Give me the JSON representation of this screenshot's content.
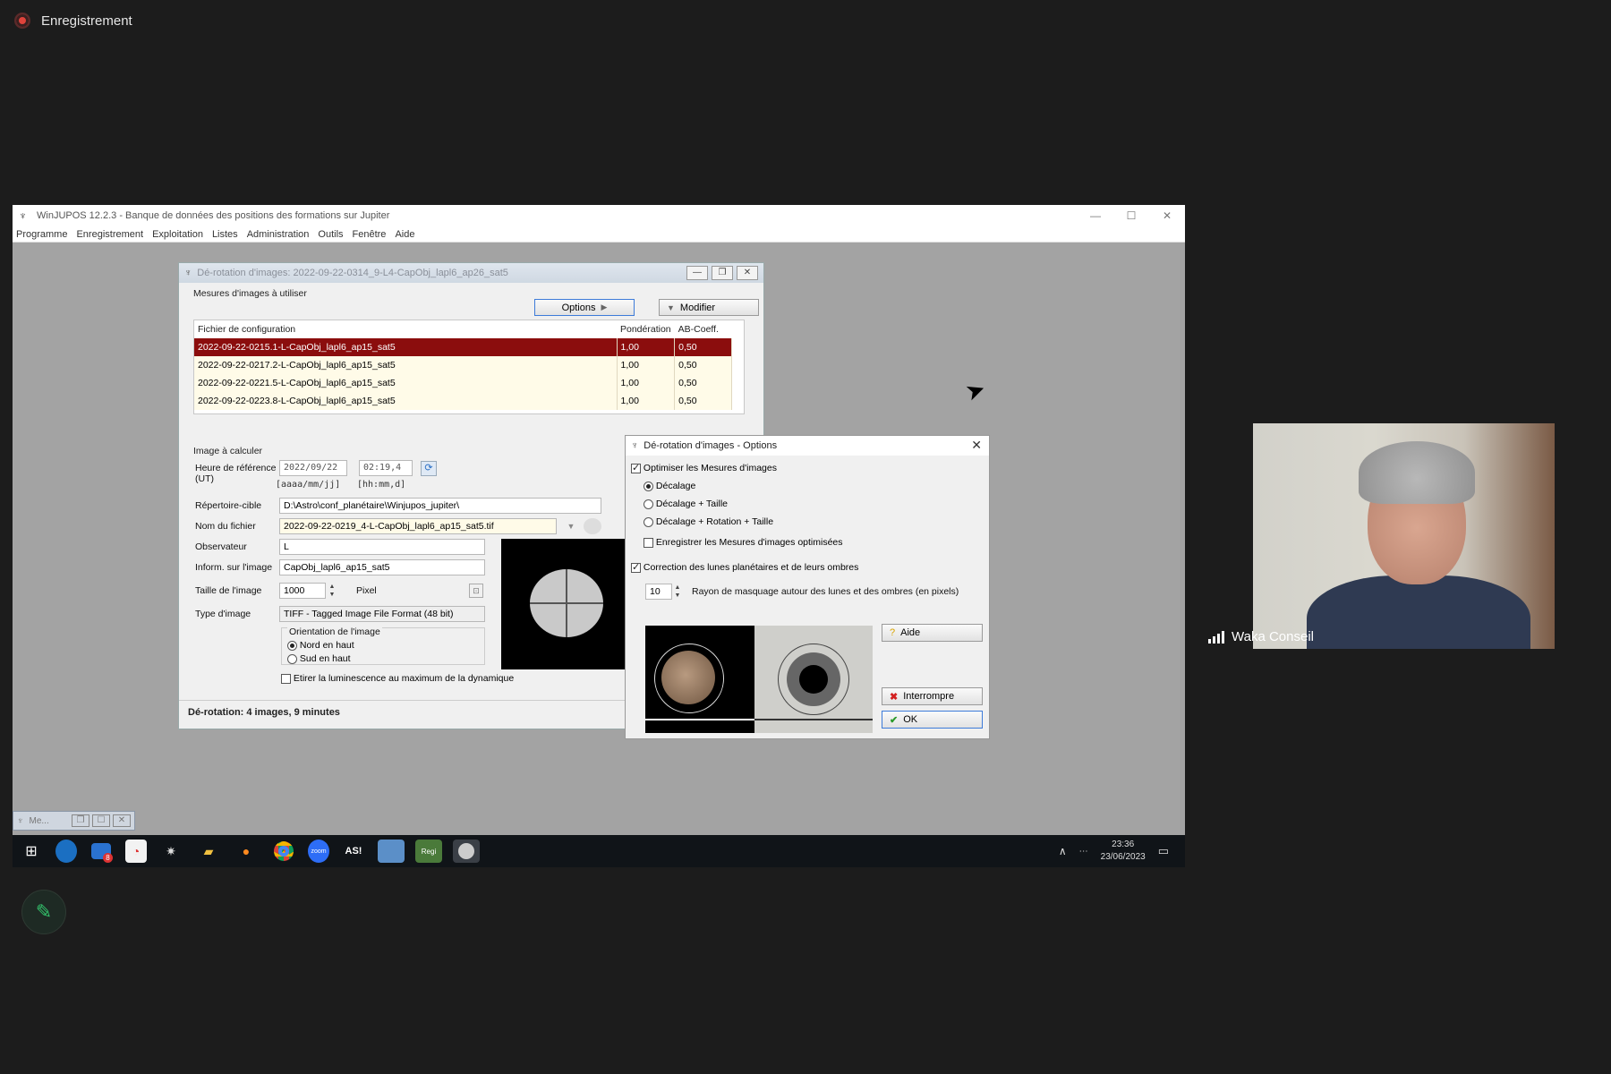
{
  "recording": {
    "label": "Enregistrement"
  },
  "app": {
    "title": "WinJUPOS 12.2.3 - Banque de données des positions des formations sur Jupiter",
    "menu": [
      "Programme",
      "Enregistrement",
      "Exploitation",
      "Listes",
      "Administration",
      "Outils",
      "Fenêtre",
      "Aide"
    ]
  },
  "derot_window": {
    "title": "Dé-rotation d'images: 2022-09-22-0314_9-L4-CapObj_lapl6_ap26_sat5",
    "group_measures": "Mesures d'images à utiliser",
    "options_btn": "Options",
    "modify_btn": "Modifier",
    "table": {
      "headers": [
        "Fichier de configuration",
        "Pondération",
        "AB-Coeff."
      ],
      "rows": [
        [
          "2022-09-22-0215.1-L-CapObj_lapl6_ap15_sat5",
          "1,00",
          "0,50"
        ],
        [
          "2022-09-22-0217.2-L-CapObj_lapl6_ap15_sat5",
          "1,00",
          "0,50"
        ],
        [
          "2022-09-22-0221.5-L-CapObj_lapl6_ap15_sat5",
          "1,00",
          "0,50"
        ],
        [
          "2022-09-22-0223.8-L-CapObj_lapl6_ap15_sat5",
          "1,00",
          "0,50"
        ]
      ]
    },
    "group_image": "Image à calculer",
    "ref_time_label": "Heure de référence (UT)",
    "ref_date": "2022/09/22",
    "ref_time": "02:19,4",
    "date_format": "[aaaa/mm/jj]",
    "time_format": "[hh:mm,d]",
    "target_dir_label": "Répertoire-cible",
    "target_dir": "D:\\Astro\\conf_planétaire\\Winjupos_jupiter\\",
    "filename_label": "Nom du fichier",
    "filename": "2022-09-22-0219_4-L-CapObj_lapl6_ap15_sat5.tif",
    "observer_label": "Observateur",
    "observer": "L",
    "info_label": "Inform. sur l'image",
    "info": "CapObj_lapl6_ap15_sat5",
    "size_label": "Taille de l'image",
    "size": "1000",
    "size_unit": "Pixel",
    "type_label": "Type d'image",
    "type": "TIFF - Tagged Image File Format (48 bit)",
    "orientation_label": "Orientation de l'image",
    "north_up": "Nord en haut",
    "south_up": "Sud en haut",
    "stretch_label": "Etirer la luminescence au maximum de la dynamique",
    "status": "Dé-rotation: 4 images, 9 minutes"
  },
  "options_dialog": {
    "title": "Dé-rotation d'images - Options",
    "optimize": "Optimiser les Mesures d'images",
    "opt1": "Décalage",
    "opt2": "Décalage + Taille",
    "opt3": "Décalage + Rotation + Taille",
    "save_opt": "Enregistrer les Mesures d'images optimisées",
    "correction": "Correction des lunes planétaires et de leurs ombres",
    "radius": "10",
    "radius_label": "Rayon de masquage autour des lunes et des ombres (en pixels)",
    "help_btn": "Aide",
    "abort_btn": "Interrompre",
    "ok_btn": "OK"
  },
  "minimized": {
    "label": "Me..."
  },
  "taskbar": {
    "time": "23:36",
    "date": "23/06/2023",
    "badge": "8"
  },
  "video": {
    "name": "Waka Conseil"
  }
}
